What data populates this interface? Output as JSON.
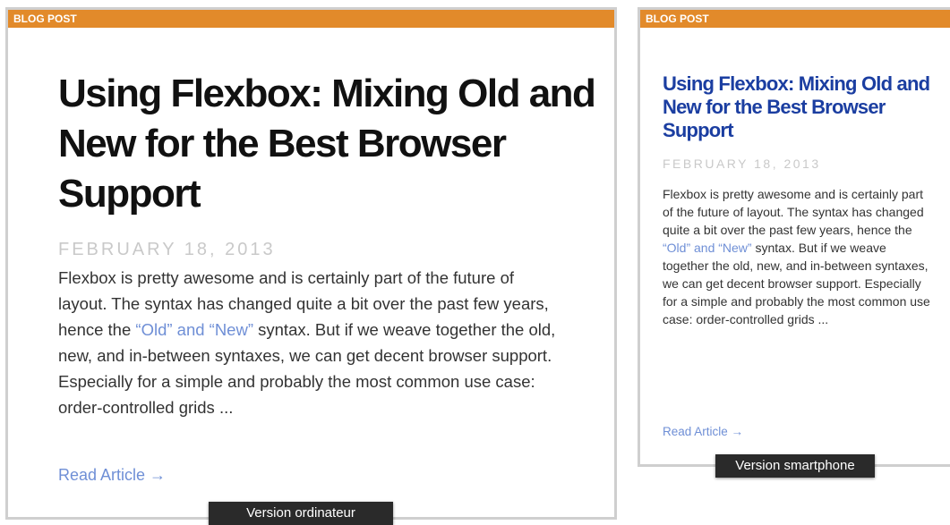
{
  "desktop": {
    "tag": "BLOG POST",
    "title": "Using Flexbox: Mixing Old and New for the Best Browser Support",
    "date": "FEBRUARY 18, 2013",
    "excerpt_before": "Flexbox is pretty awesome and is certainly part of the future of layout. The syntax has changed quite a bit over the past few years, hence the ",
    "excerpt_link": "“Old” and “New”",
    "excerpt_after": " syntax. But if we weave together the old, new, and in-between syntaxes, we can get decent browser support. Especially for a simple and probably the most common use case: order-controlled grids ...",
    "read_more": "Read Article →",
    "caption": "Version ordinateur"
  },
  "mobile": {
    "tag": "BLOG POST",
    "title": "Using Flexbox: Mixing Old and New for the Best Browser Support",
    "date": "FEBRUARY 18, 2013",
    "excerpt_before": "Flexbox is pretty awesome and is certainly part of the future of layout. The syntax has changed quite a bit over the past few years, hence the ",
    "excerpt_link": "“Old” and “New”",
    "excerpt_after": " syntax. But if we weave together the old, new, and in-between syntaxes, we can get decent browser support. Especially for a simple and probably the most common use case: order-controlled grids ...",
    "read_more": "Read Article →",
    "caption": "Version smartphone"
  },
  "colors": {
    "tag_background": "#e28a2a",
    "link": "#6f8fd6",
    "mobile_title": "#1b3ea1",
    "date": "#c9c9c9"
  }
}
